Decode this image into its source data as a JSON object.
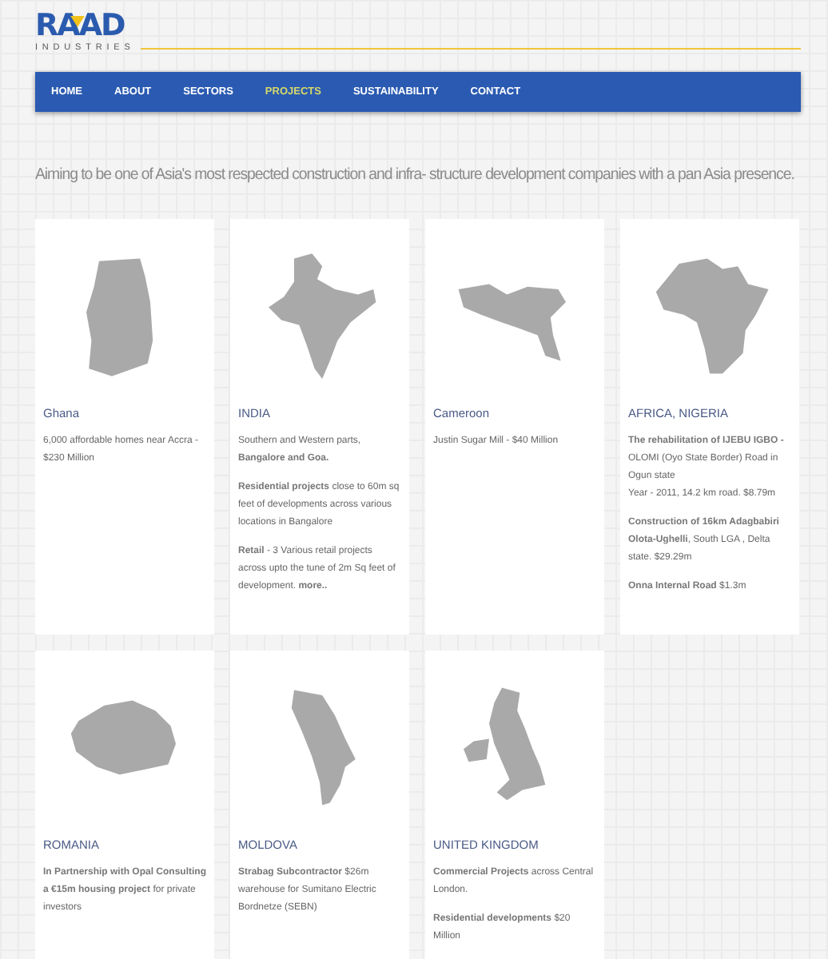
{
  "logo": {
    "name": "RAAD",
    "subtitle": "INDUSTRIES"
  },
  "nav": [
    {
      "label": "HOME",
      "selected": false
    },
    {
      "label": "ABOUT",
      "selected": false
    },
    {
      "label": "SECTORS",
      "selected": false
    },
    {
      "label": "PROJECTS",
      "selected": true
    },
    {
      "label": "SUSTAINABILITY",
      "selected": false
    },
    {
      "label": "CONTACT",
      "selected": false
    }
  ],
  "tagline": "Aiming to be one of Asia's most respected construction and infra- structure development companies with a pan Asia presence.",
  "projects": [
    {
      "kind": "ghana",
      "title": "Ghana",
      "paragraphs": [
        "6,000 affordable homes near Accra - $230 Million"
      ]
    },
    {
      "kind": "india",
      "title": "INDIA",
      "paragraphs": [
        "Southern and Western parts, **Bangalore and Goa.**",
        "**Residential projects** close to 60m sq feet of developments across various locations in Bangalore",
        "**Retail** - 3 Various retail projects across upto the tune of 2m Sq feet of development. **more..**"
      ]
    },
    {
      "kind": "cameroon",
      "title": "Cameroon",
      "paragraphs": [
        "Justin Sugar Mill - $40 Million"
      ]
    },
    {
      "kind": "africa",
      "title": "AFRICA, NIGERIA",
      "paragraphs": [
        "**The rehabilitation of IJEBU IGBO -** OLOMI (Oyo State Border) Road in Ogun state\nYear - 2011, 14.2 km road. $8.79m",
        "**Construction of 16km Adagbabiri Olota-Ughelli**, South LGA , Delta state. $29.29m",
        "**Onna Internal Road** $1.3m"
      ]
    },
    {
      "kind": "romania",
      "title": "ROMANIA",
      "paragraphs": [
        "**In Partnership with Opal Consulting a €15m housing project** for private investors"
      ]
    },
    {
      "kind": "moldova",
      "title": "MOLDOVA",
      "paragraphs": [
        "**Strabag Subcontractor** $26m warehouse for Sumitano Electric Bordnetze (SEBN)"
      ]
    },
    {
      "kind": "uk",
      "title": "UNITED KINGDOM",
      "paragraphs": [
        "**Commercial Projects** across Central London.",
        "**Residential developments** $20 Million"
      ]
    }
  ]
}
